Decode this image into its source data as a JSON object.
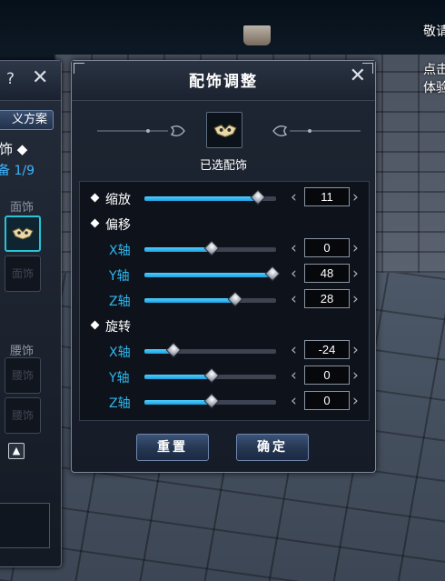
{
  "scene_hints": {
    "top_right_1": "敬请",
    "top_right_2": "点击",
    "top_right_3": "体验"
  },
  "side_panel": {
    "help_glyph": "?",
    "close_glyph": "✕",
    "scheme_tab": "义方案",
    "title": "饰 ◆",
    "count": "备 1/9",
    "cat_face": "面饰",
    "face_slot_empty": "面饰",
    "cat_waist": "腰饰",
    "waist_slot_1": "腰饰",
    "waist_slot_2": "腰饰",
    "small_btn_glyph": "▲"
  },
  "dialog": {
    "title": "配饰调整",
    "close_glyph": "✕",
    "preview_label": "已选配饰",
    "rows": {
      "scale": {
        "label": "缩放",
        "value": "11",
        "fraction": 0.86
      },
      "offset": {
        "label": "偏移"
      },
      "offset_x": {
        "label": "X轴",
        "value": "0",
        "fraction": 0.51
      },
      "offset_y": {
        "label": "Y轴",
        "value": "48",
        "fraction": 0.97
      },
      "offset_z": {
        "label": "Z轴",
        "value": "28",
        "fraction": 0.69
      },
      "rotate": {
        "label": "旋转"
      },
      "rotate_x": {
        "label": "X轴",
        "value": "-24",
        "fraction": 0.22
      },
      "rotate_y": {
        "label": "Y轴",
        "value": "0",
        "fraction": 0.51
      },
      "rotate_z": {
        "label": "Z轴",
        "value": "0",
        "fraction": 0.51
      }
    },
    "arrow_left": "‹",
    "arrow_right": "›",
    "reset_button": "重置",
    "confirm_button": "确定"
  },
  "colors": {
    "accent_blue": "#2fb6ee",
    "slider_fill": "#1f9fe0",
    "selected_slot": "#27c4d6"
  }
}
